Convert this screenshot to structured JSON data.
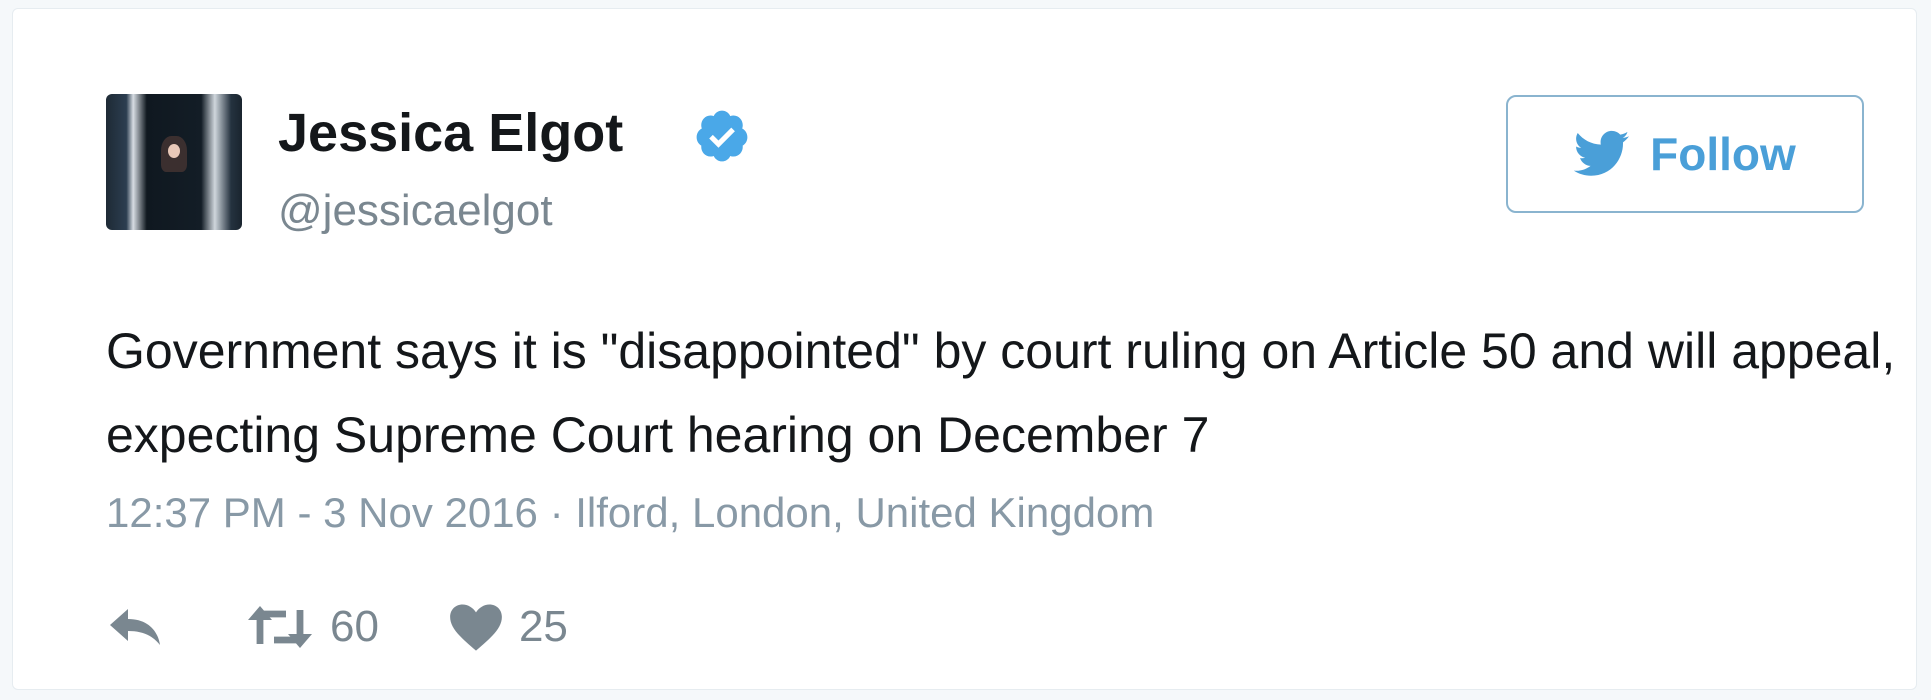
{
  "tweet": {
    "author": {
      "display_name": "Jessica Elgot",
      "handle": "@jessicaelgot",
      "verified_icon": "verified-badge-icon",
      "avatar": "author-avatar"
    },
    "follow_button": {
      "label": "Follow",
      "icon": "twitter-bird-icon"
    },
    "text": "Government says it is \"disappointed\" by court ruling on Article 50 and will appeal, expecting Supreme Court hearing on December 7",
    "timestamp": "12:37 PM - 3 Nov 2016",
    "separator": "·",
    "location": "Ilford, London, United Kingdom",
    "actions": {
      "reply": {
        "icon": "reply-icon"
      },
      "retweet": {
        "icon": "retweet-icon",
        "count": "60"
      },
      "like": {
        "icon": "heart-icon",
        "count": "25"
      }
    }
  },
  "colors": {
    "text_primary": "#14171a",
    "text_secondary": "#8899a6",
    "accent_blue": "#4a9fd8",
    "verified_blue": "#4aa8e8",
    "follow_border": "#8ab4cf",
    "icon_gray": "#7a8790"
  }
}
